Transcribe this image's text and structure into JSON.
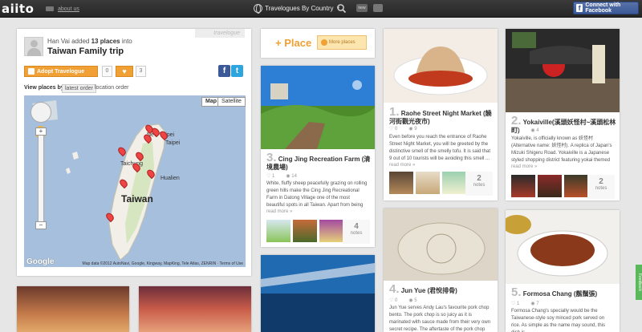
{
  "header": {
    "logo": "aiito",
    "about_label": "about us",
    "travelogues_label": "Travelogues By Country",
    "new_label": "new",
    "facebook_label": "Connect with Facebook"
  },
  "travelogue": {
    "tag": "travelogue",
    "author": "Han Vai",
    "added_text": "added",
    "count": "13 places",
    "into_text": "into",
    "title": "Taiwan Family trip",
    "adopt_label": "Adopt Travelogue",
    "adopt_count": "0",
    "like_count": "3",
    "view_places_label": "View places by :",
    "order_latest": "latest order",
    "order_location": "location order"
  },
  "map": {
    "type_map": "Map",
    "type_satellite": "Satellite",
    "country_label": "Taiwan",
    "city_labels": [
      "New Taipei",
      "Taipei",
      "Taichung",
      "Hualien",
      "Taoyuan"
    ],
    "google_label": "Google",
    "attribution": "Map data ©2012 AutoNavi, Google, Kingway, MapKing, Tele Atlas, ZENRIN · Terms of Use"
  },
  "add_place": {
    "label": "+ Place",
    "more_label": "More places"
  },
  "places": [
    {
      "num": "3.",
      "title": "Cing Jing Recreation Farm (清境農場)",
      "likes": "1",
      "views": "14",
      "desc": "White, fluffy sheep peacefully grazing on rolling green hills make the Cing Jing Recreational Farm in Datong Village one of the most beautiful spots in all Taiwan. Apart from being an ideal locatio ...",
      "read_more": "read more »",
      "notes_count": "4",
      "notes_label": "notes"
    },
    {
      "num": "1.",
      "title": "Raohe Street Night Market (饒河街觀光夜市)",
      "likes": "0",
      "views": "9",
      "desc": "Even before you reach the entrance of Raohe Street Night Market, you will be greeted by the distinctive smell of the smelly tofu. It is said that 9 out of 10 tourists will be avoiding this smell ...",
      "read_more": "read more »",
      "notes_count": "2",
      "notes_label": "notes"
    },
    {
      "num": "2.",
      "title": "Yokaiville(溪頭妖怪村~溪頭松林町)",
      "likes": "0",
      "views": "4",
      "desc": "Yokaiville, is officially known as 妖怪村 (Alternative name: 妖怪村). A replica of Japan's Mizuki Shigeru Road. Yokaiville is a Japanese styled shopping district featuring yokai themed ...",
      "read_more": "read more »",
      "notes_count": "2",
      "notes_label": "notes"
    },
    {
      "num": "4.",
      "title": "Jun Yue (君悅排骨)",
      "likes": "0",
      "views": "5",
      "desc": "Jun Yue serves Andy Lau's favourite pork chop bento. The pork chop is so juicy as it is marinated with sauce made from their very own secret recipe. The aftertaste of the pork chop will leave"
    },
    {
      "num": "5.",
      "title": "Formosa Chang (鬍鬚張)",
      "likes": "1",
      "views": "7",
      "desc": "Formosa Chang's specially would be the Taiwanese-style soy minced pork served on rice. As simple as the name may sound, this dish is"
    }
  ],
  "feedback_label": "Feedback"
}
